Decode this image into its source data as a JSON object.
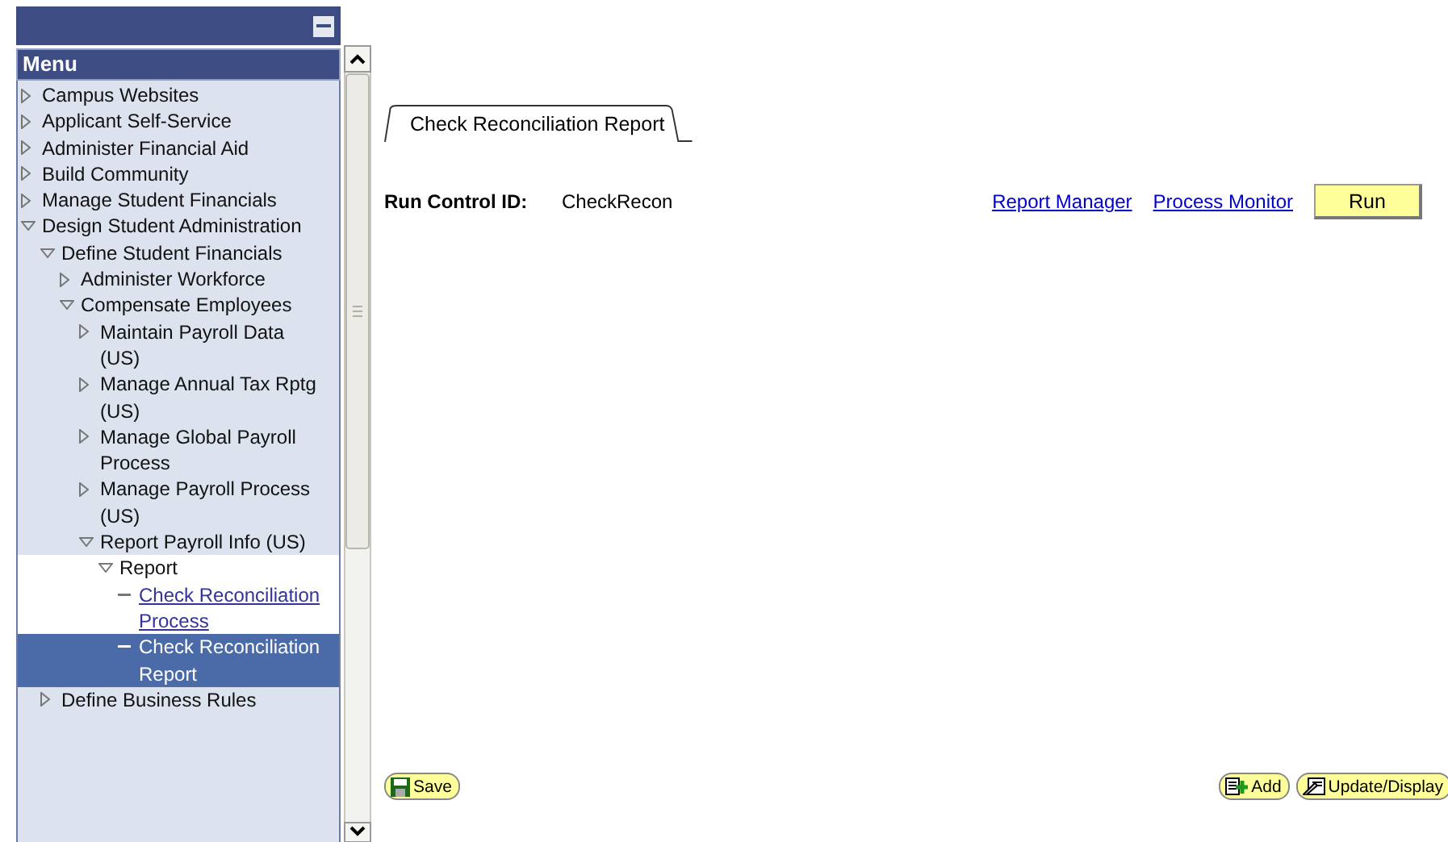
{
  "menu": {
    "title": "Menu",
    "items": [
      {
        "label": "Campus Websites",
        "kind": "folder",
        "expanded": false
      },
      {
        "label": "Applicant Self-Service",
        "kind": "folder",
        "expanded": false
      },
      {
        "label": "Administer Financial Aid",
        "kind": "folder",
        "expanded": false
      },
      {
        "label": "Build Community",
        "kind": "folder",
        "expanded": false
      },
      {
        "label": "Manage Student Financials",
        "kind": "folder",
        "expanded": false
      },
      {
        "label": "Design Student Administration",
        "kind": "folder",
        "expanded": true,
        "children": [
          {
            "label": "Define Student Financials",
            "kind": "folder",
            "expanded": true,
            "children": [
              {
                "label": "Administer Workforce",
                "kind": "folder",
                "expanded": false
              },
              {
                "label": "Compensate Employees",
                "kind": "folder",
                "expanded": true,
                "children": [
                  {
                    "label": "Maintain Payroll Data (US)",
                    "kind": "folder",
                    "expanded": false
                  },
                  {
                    "label": "Manage Annual Tax Rptg (US)",
                    "kind": "folder",
                    "expanded": false
                  },
                  {
                    "label": "Manage Global Payroll Process",
                    "kind": "folder",
                    "expanded": false
                  },
                  {
                    "label": "Manage Payroll Process (US)",
                    "kind": "folder",
                    "expanded": false
                  },
                  {
                    "label": "Report Payroll Info (US)",
                    "kind": "folder",
                    "expanded": true,
                    "children": [
                      {
                        "label": "Report",
                        "kind": "folder",
                        "expanded": true,
                        "current": true,
                        "children": [
                          {
                            "label": "Check Reconciliation Process",
                            "kind": "leaf",
                            "selected": false
                          },
                          {
                            "label": "Check Reconciliation Report",
                            "kind": "leaf",
                            "selected": true
                          }
                        ]
                      }
                    ]
                  }
                ]
              }
            ]
          },
          {
            "label": "Define Business Rules",
            "kind": "folder",
            "expanded": false
          }
        ]
      }
    ]
  },
  "tab": {
    "label": "Check Reconciliation Report"
  },
  "run_control": {
    "label": "Run Control ID:",
    "value": "CheckRecon"
  },
  "links": [
    "Report Manager",
    "Process Monitor"
  ],
  "run_button": "Run",
  "footer": {
    "save": "Save",
    "add": "Add",
    "update": "Update/Display"
  }
}
